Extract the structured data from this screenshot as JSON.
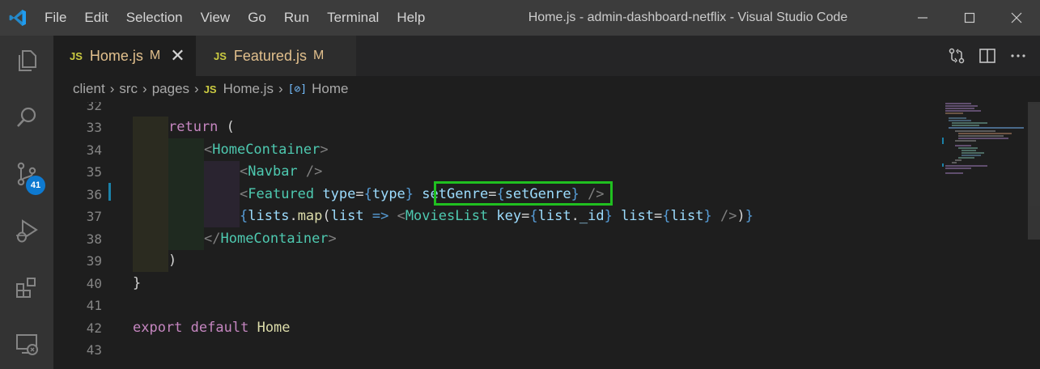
{
  "window": {
    "menu": [
      "File",
      "Edit",
      "Selection",
      "View",
      "Go",
      "Run",
      "Terminal",
      "Help"
    ],
    "title": "Home.js - admin-dashboard-netflix - Visual Studio Code"
  },
  "activity": {
    "scm_badge": "41"
  },
  "tabs": [
    {
      "icon": "JS",
      "name": "Home.js",
      "status": "M",
      "close": "✕",
      "active": true
    },
    {
      "icon": "JS",
      "name": "Featured.js",
      "status": "M",
      "active": false
    }
  ],
  "breadcrumb": {
    "parts": [
      "client",
      "src",
      "pages"
    ],
    "file_icon": "JS",
    "file": "Home.js",
    "symbol_icon": "[⊘]",
    "symbol": "Home"
  },
  "editor": {
    "line_numbers": [
      "32",
      "33",
      "34",
      "35",
      "36",
      "37",
      "38",
      "39",
      "40",
      "41",
      "42",
      "43"
    ],
    "code": {
      "l33": {
        "kw": "return",
        "rest": " ("
      },
      "l34": {
        "open": "<",
        "tag": "HomeContainer",
        "close": ">"
      },
      "l35": {
        "open": "<",
        "tag": "Navbar",
        "close": " />"
      },
      "l36": {
        "open": "<",
        "tag": "Featured",
        "attr1": "type",
        "eq1": "=",
        "lb1": "{",
        "val1": "type",
        "rb1": "}",
        "attr2": "setGenre",
        "eq2": "=",
        "lb2": "{",
        "val2": "setGenre",
        "rb2": "}",
        "close": " />"
      },
      "l37": {
        "lb": "{",
        "obj": "lists",
        "dot": ".",
        "fn": "map",
        "p1": "(",
        "param": "list",
        "arrow": " => ",
        "open": "<",
        "tag": "MoviesList",
        "attr1": "key",
        "eq1": "=",
        "lb1": "{",
        "val1a": "list",
        "dot1": ".",
        "val1b": "_id",
        "rb1": "}",
        "attr2": "list",
        "eq2": "=",
        "lb2": "{",
        "val2": "list",
        "rb2": "}",
        "close": " />",
        "p2": ")",
        "rb": "}"
      },
      "l38": {
        "open": "</",
        "tag": "HomeContainer",
        "close": ">"
      },
      "l39": {
        "text": ")"
      },
      "l40": {
        "text": "}"
      },
      "l42": {
        "kw1": "export",
        "kw2": "default",
        "name": "Home"
      }
    }
  },
  "colors": {
    "highlight_box": "#20c020",
    "badge": "#0e7ad1"
  }
}
